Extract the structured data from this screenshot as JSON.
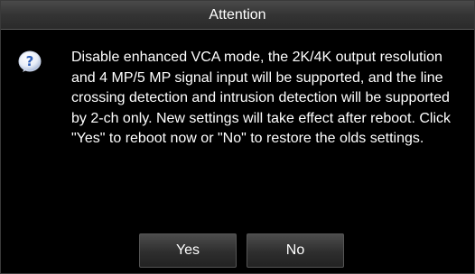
{
  "dialog": {
    "title": "Attention",
    "icon": "question-icon",
    "message": "Disable enhanced VCA mode, the 2K/4K output resolution and 4 MP/5 MP signal input will be supported, and the line crossing detection and intrusion detection will be supported by 2-ch only. New settings will take effect after reboot. Click \"Yes\" to reboot now or \"No\" to restore the olds settings.",
    "yes_label": "Yes",
    "no_label": "No"
  },
  "colors": {
    "background": "#000000",
    "text": "#ffffff",
    "icon_blue": "#2f5fb8"
  }
}
